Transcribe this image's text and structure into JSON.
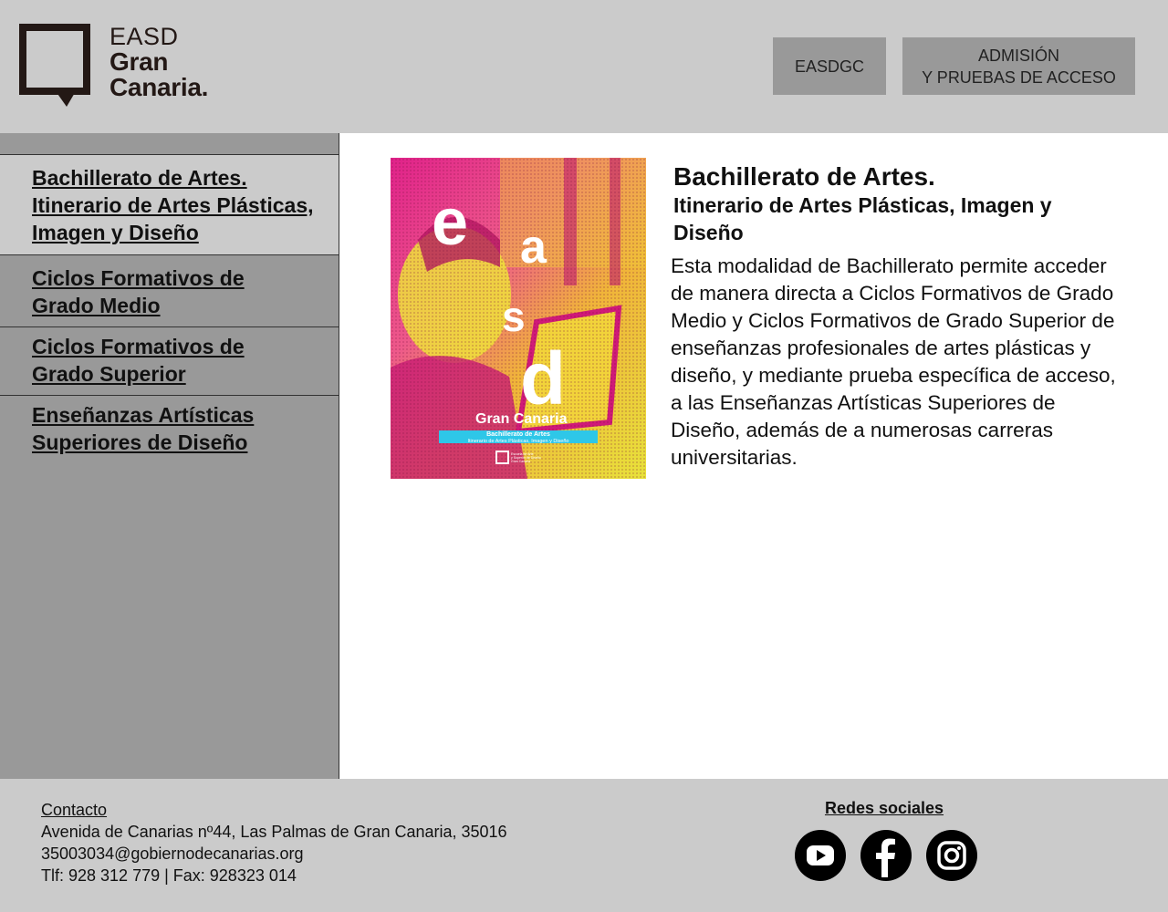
{
  "header": {
    "logo": {
      "line1": "EASD",
      "line2": "Gran",
      "line3": "Canaria."
    },
    "nav": [
      {
        "label": "EASDGC"
      },
      {
        "label_line1": "ADMISIÓN",
        "label_line2": "Y PRUEBAS DE ACCESO"
      }
    ]
  },
  "sidebar": {
    "items": [
      {
        "line1": "Bachillerato de Artes.",
        "line2": "Itinerario de Artes Plásticas,",
        "line3": "Imagen y Diseño"
      },
      {
        "line1": "Ciclos Formativos de",
        "line2": "Grado Medio"
      },
      {
        "line1": "Ciclos Formativos de",
        "line2": "Grado Superior"
      },
      {
        "line1": "Enseñanzas Artísticas",
        "line2": "Superiores de Diseño"
      }
    ]
  },
  "main": {
    "cover": {
      "letters": [
        "e",
        "a",
        "s",
        "d"
      ],
      "brand": "Gran Canaria",
      "band_line1": "Bachillerato de Artes",
      "band_line2": "Itinerario de Artes Plásticas, Imagen y Diseño",
      "seal_line1": "Escuela de Arte",
      "seal_line2": "y Superior de Diseño",
      "seal_line3": "Gran Canaria",
      "colors": {
        "magenta": "#e0218a",
        "yellow": "#e8e23a",
        "band": "#2ec7e8"
      }
    },
    "title": "Bachillerato de Artes.",
    "subtitle": "Itinerario de Artes Plásticas, Imagen y Diseño",
    "body": "Esta modalidad de Bachillerato permite acce­der de manera directa a Ciclos Formativos de Grado Medio y Ciclos Formativos de Grado Su­perior de enseñanzas profesionales de artes plásticas y diseño, y mediante prueba específi­ca de acceso, a las Enseñanzas Artísticas Supe­riores de Diseño, además de a numerosas ca­rreras universitarias."
  },
  "footer": {
    "contact_label": "Contacto",
    "address": "Avenida de Canarias nº44, Las Palmas de Gran Canaria, 35016",
    "email": "35003034@gobiernodecanarias.org",
    "phone": "Tlf: 928 312 779 | Fax: 928323 014",
    "social_title": "Redes sociales",
    "social_icons": [
      "youtube-icon",
      "facebook-icon",
      "instagram-icon"
    ]
  }
}
